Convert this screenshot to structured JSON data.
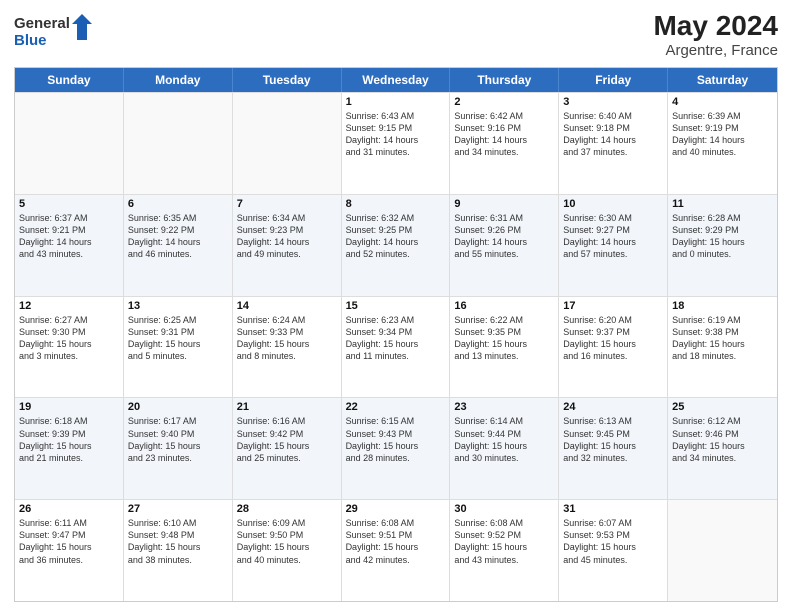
{
  "header": {
    "logo_general": "General",
    "logo_blue": "Blue",
    "month_year": "May 2024",
    "location": "Argentre, France"
  },
  "calendar": {
    "days_of_week": [
      "Sunday",
      "Monday",
      "Tuesday",
      "Wednesday",
      "Thursday",
      "Friday",
      "Saturday"
    ],
    "rows": [
      {
        "alt": false,
        "cells": [
          {
            "day": "",
            "lines": []
          },
          {
            "day": "",
            "lines": []
          },
          {
            "day": "",
            "lines": []
          },
          {
            "day": "1",
            "lines": [
              "Sunrise: 6:43 AM",
              "Sunset: 9:15 PM",
              "Daylight: 14 hours",
              "and 31 minutes."
            ]
          },
          {
            "day": "2",
            "lines": [
              "Sunrise: 6:42 AM",
              "Sunset: 9:16 PM",
              "Daylight: 14 hours",
              "and 34 minutes."
            ]
          },
          {
            "day": "3",
            "lines": [
              "Sunrise: 6:40 AM",
              "Sunset: 9:18 PM",
              "Daylight: 14 hours",
              "and 37 minutes."
            ]
          },
          {
            "day": "4",
            "lines": [
              "Sunrise: 6:39 AM",
              "Sunset: 9:19 PM",
              "Daylight: 14 hours",
              "and 40 minutes."
            ]
          }
        ]
      },
      {
        "alt": true,
        "cells": [
          {
            "day": "5",
            "lines": [
              "Sunrise: 6:37 AM",
              "Sunset: 9:21 PM",
              "Daylight: 14 hours",
              "and 43 minutes."
            ]
          },
          {
            "day": "6",
            "lines": [
              "Sunrise: 6:35 AM",
              "Sunset: 9:22 PM",
              "Daylight: 14 hours",
              "and 46 minutes."
            ]
          },
          {
            "day": "7",
            "lines": [
              "Sunrise: 6:34 AM",
              "Sunset: 9:23 PM",
              "Daylight: 14 hours",
              "and 49 minutes."
            ]
          },
          {
            "day": "8",
            "lines": [
              "Sunrise: 6:32 AM",
              "Sunset: 9:25 PM",
              "Daylight: 14 hours",
              "and 52 minutes."
            ]
          },
          {
            "day": "9",
            "lines": [
              "Sunrise: 6:31 AM",
              "Sunset: 9:26 PM",
              "Daylight: 14 hours",
              "and 55 minutes."
            ]
          },
          {
            "day": "10",
            "lines": [
              "Sunrise: 6:30 AM",
              "Sunset: 9:27 PM",
              "Daylight: 14 hours",
              "and 57 minutes."
            ]
          },
          {
            "day": "11",
            "lines": [
              "Sunrise: 6:28 AM",
              "Sunset: 9:29 PM",
              "Daylight: 15 hours",
              "and 0 minutes."
            ]
          }
        ]
      },
      {
        "alt": false,
        "cells": [
          {
            "day": "12",
            "lines": [
              "Sunrise: 6:27 AM",
              "Sunset: 9:30 PM",
              "Daylight: 15 hours",
              "and 3 minutes."
            ]
          },
          {
            "day": "13",
            "lines": [
              "Sunrise: 6:25 AM",
              "Sunset: 9:31 PM",
              "Daylight: 15 hours",
              "and 5 minutes."
            ]
          },
          {
            "day": "14",
            "lines": [
              "Sunrise: 6:24 AM",
              "Sunset: 9:33 PM",
              "Daylight: 15 hours",
              "and 8 minutes."
            ]
          },
          {
            "day": "15",
            "lines": [
              "Sunrise: 6:23 AM",
              "Sunset: 9:34 PM",
              "Daylight: 15 hours",
              "and 11 minutes."
            ]
          },
          {
            "day": "16",
            "lines": [
              "Sunrise: 6:22 AM",
              "Sunset: 9:35 PM",
              "Daylight: 15 hours",
              "and 13 minutes."
            ]
          },
          {
            "day": "17",
            "lines": [
              "Sunrise: 6:20 AM",
              "Sunset: 9:37 PM",
              "Daylight: 15 hours",
              "and 16 minutes."
            ]
          },
          {
            "day": "18",
            "lines": [
              "Sunrise: 6:19 AM",
              "Sunset: 9:38 PM",
              "Daylight: 15 hours",
              "and 18 minutes."
            ]
          }
        ]
      },
      {
        "alt": true,
        "cells": [
          {
            "day": "19",
            "lines": [
              "Sunrise: 6:18 AM",
              "Sunset: 9:39 PM",
              "Daylight: 15 hours",
              "and 21 minutes."
            ]
          },
          {
            "day": "20",
            "lines": [
              "Sunrise: 6:17 AM",
              "Sunset: 9:40 PM",
              "Daylight: 15 hours",
              "and 23 minutes."
            ]
          },
          {
            "day": "21",
            "lines": [
              "Sunrise: 6:16 AM",
              "Sunset: 9:42 PM",
              "Daylight: 15 hours",
              "and 25 minutes."
            ]
          },
          {
            "day": "22",
            "lines": [
              "Sunrise: 6:15 AM",
              "Sunset: 9:43 PM",
              "Daylight: 15 hours",
              "and 28 minutes."
            ]
          },
          {
            "day": "23",
            "lines": [
              "Sunrise: 6:14 AM",
              "Sunset: 9:44 PM",
              "Daylight: 15 hours",
              "and 30 minutes."
            ]
          },
          {
            "day": "24",
            "lines": [
              "Sunrise: 6:13 AM",
              "Sunset: 9:45 PM",
              "Daylight: 15 hours",
              "and 32 minutes."
            ]
          },
          {
            "day": "25",
            "lines": [
              "Sunrise: 6:12 AM",
              "Sunset: 9:46 PM",
              "Daylight: 15 hours",
              "and 34 minutes."
            ]
          }
        ]
      },
      {
        "alt": false,
        "cells": [
          {
            "day": "26",
            "lines": [
              "Sunrise: 6:11 AM",
              "Sunset: 9:47 PM",
              "Daylight: 15 hours",
              "and 36 minutes."
            ]
          },
          {
            "day": "27",
            "lines": [
              "Sunrise: 6:10 AM",
              "Sunset: 9:48 PM",
              "Daylight: 15 hours",
              "and 38 minutes."
            ]
          },
          {
            "day": "28",
            "lines": [
              "Sunrise: 6:09 AM",
              "Sunset: 9:50 PM",
              "Daylight: 15 hours",
              "and 40 minutes."
            ]
          },
          {
            "day": "29",
            "lines": [
              "Sunrise: 6:08 AM",
              "Sunset: 9:51 PM",
              "Daylight: 15 hours",
              "and 42 minutes."
            ]
          },
          {
            "day": "30",
            "lines": [
              "Sunrise: 6:08 AM",
              "Sunset: 9:52 PM",
              "Daylight: 15 hours",
              "and 43 minutes."
            ]
          },
          {
            "day": "31",
            "lines": [
              "Sunrise: 6:07 AM",
              "Sunset: 9:53 PM",
              "Daylight: 15 hours",
              "and 45 minutes."
            ]
          },
          {
            "day": "",
            "lines": []
          }
        ]
      }
    ]
  }
}
